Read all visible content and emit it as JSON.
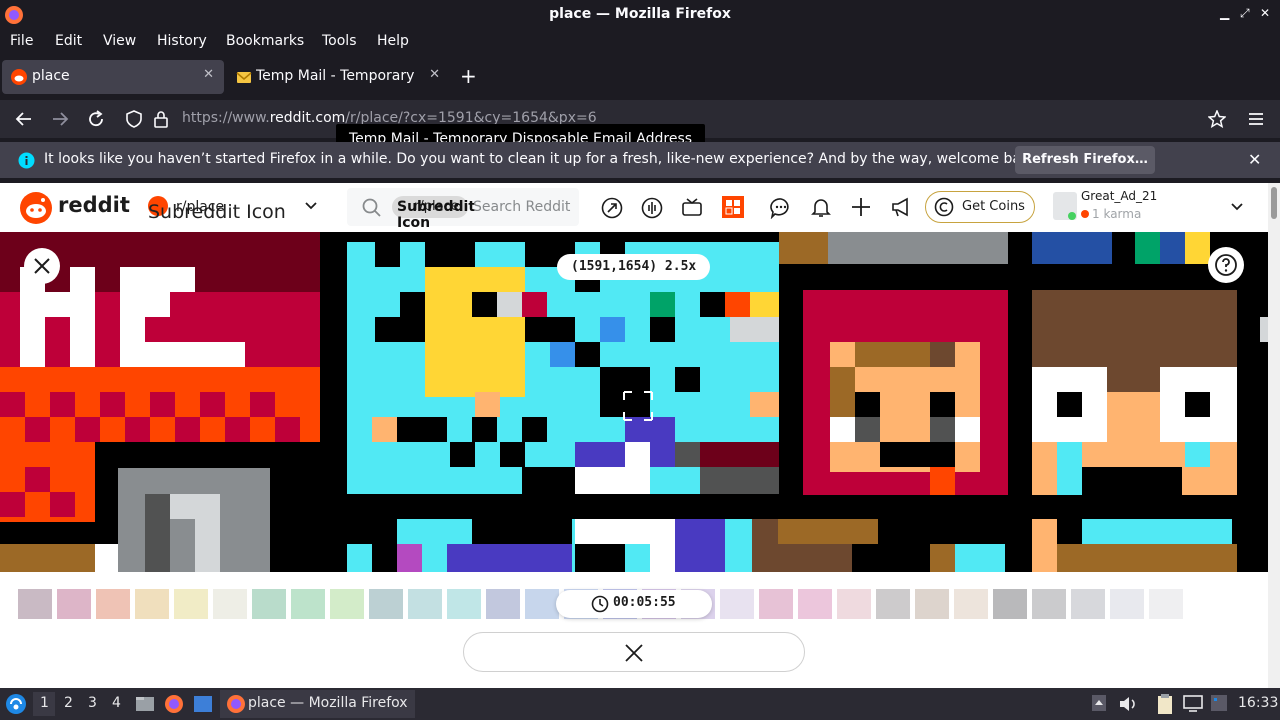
{
  "window": {
    "title": "place — Mozilla Firefox"
  },
  "menu": [
    "File",
    "Edit",
    "View",
    "History",
    "Bookmarks",
    "Tools",
    "Help"
  ],
  "tabs": [
    {
      "label": "place",
      "active": true
    },
    {
      "label": "Temp Mail - Temporary Disposable Email Address",
      "active": false
    }
  ],
  "tab_tooltip": "Temp Mail - Temporary Disposable Email Address",
  "url": {
    "prefix": "https://www.",
    "domain": "reddit.com",
    "path": "/r/place/?cx=1591&cy=1654&px=6"
  },
  "notification": {
    "message": "It looks like you haven’t started Firefox in a while. Do you want to clean it up for a fresh, like-new experience? And by the way, welcome back!",
    "button": "Refresh Firefox…"
  },
  "reddit": {
    "logo_text": "reddit",
    "subreddit_icon_alt": "Subreddit Icon",
    "subreddit": "r/place",
    "search_chip_alt": "Subreddit Icon",
    "search_chip_text": "r/place",
    "search_placeholder": "Search Reddit",
    "get_coins": "Get Coins",
    "username": "Great_Ad_21",
    "karma": "1 karma",
    "brand_color": "#ff4500"
  },
  "place": {
    "coords": "(1591,1654) 2.5x",
    "timer": "00:05:55",
    "palette": [
      "#c9bac4",
      "#ddb5c8",
      "#efc3b5",
      "#f0dfbd",
      "#f1ecc6",
      "#eeeee6",
      "#b9dccb",
      "#bde3cb",
      "#d3ecc9",
      "#bcd0d3",
      "#c3e0e2",
      "#c0e6e7",
      "#c2c8de",
      "#c7d6ec",
      "#ccd9f3",
      "#c2c6ee",
      "#d7c6ea",
      "#dcd2ec",
      "#e8e2f0",
      "#e7c2d6",
      "#ecc6dc",
      "#efdadf",
      "#cdcbcc",
      "#ddd4cd",
      "#ede4dc",
      "#b9b9bb",
      "#cbcbcd",
      "#d7d8dc",
      "#e8e9ee",
      "#efeff1"
    ]
  },
  "taskbar": {
    "workspaces": [
      "1",
      "2",
      "3",
      "4"
    ],
    "task_label": "place — Mozilla Firefox",
    "clock": "16:33"
  }
}
